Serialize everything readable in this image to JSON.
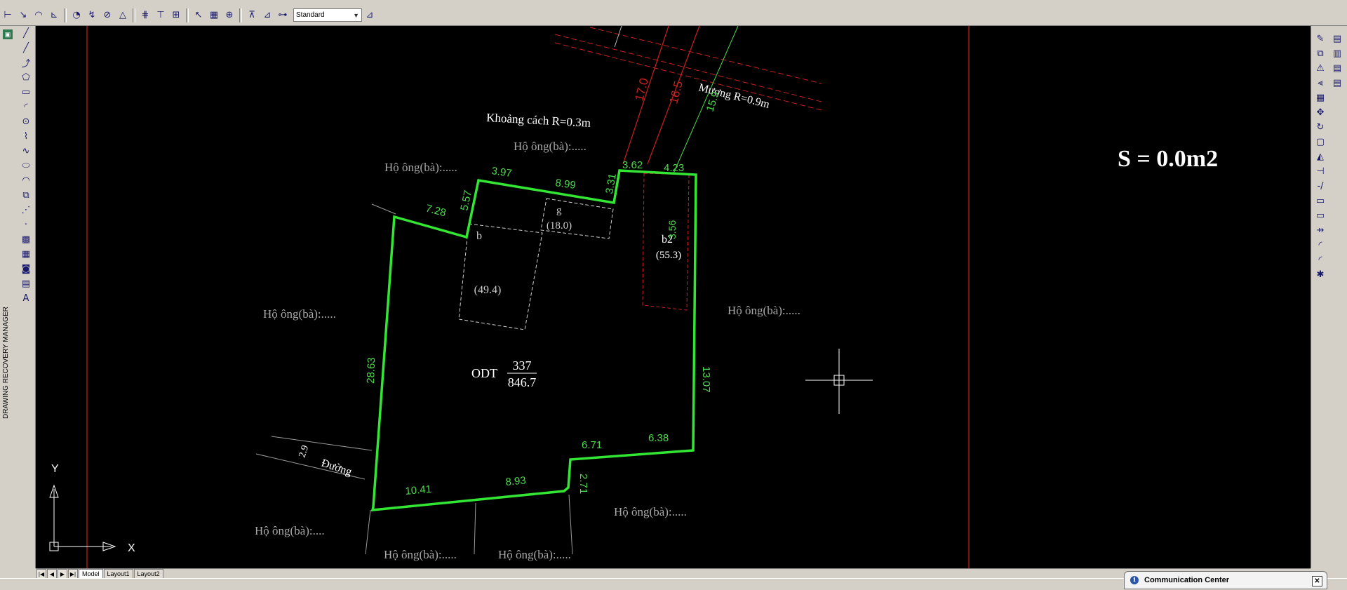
{
  "toolbar": {
    "dim_style_value": "Standard",
    "icons": [
      "dim-linear-icon",
      "dim-aligned-icon",
      "dim-arc-length-icon",
      "dim-ordinate-icon",
      "dim-radius-icon",
      "dim-jogged-icon",
      "dim-diameter-icon",
      "dim-angular-icon",
      "quick-dim-icon",
      "dim-baseline-icon",
      "dim-continue-icon",
      "quick-leader-icon",
      "tolerance-icon",
      "center-mark-icon",
      "dim-edit-icon",
      "dim-text-edit-icon",
      "dim-update-icon",
      "dim-style-icon"
    ]
  },
  "left_panel": {
    "label": "DRAWING RECOVERY MANAGER",
    "icon_glyph": "▣"
  },
  "draw_toolbar": {
    "glyphs": [
      "╱",
      "╱",
      "⤴",
      "⬠",
      "▭",
      "◜",
      "⊙",
      "⌇",
      "∿",
      "⬭",
      "◠",
      "⧉",
      "⋰",
      "·",
      "▩",
      "▦",
      "◙",
      "▤",
      "A"
    ]
  },
  "modify_toolbar": {
    "col1": [
      "✎",
      "⧉",
      "⚠",
      "⫷",
      "▦",
      "✥",
      "↻",
      "▢",
      "◭",
      "⊣",
      "-/",
      "▭",
      "▭",
      "⇸",
      "◜",
      "◜",
      "✱"
    ],
    "col2": [
      "▤",
      "▥",
      "▤",
      "▤"
    ]
  },
  "drawing": {
    "area_label": "S = 0.0m2",
    "parcel_prefix": "ODT",
    "parcel_number": "337",
    "parcel_area": "846.7",
    "building_b_label": "b",
    "building_b_area": "(49.4)",
    "building_g_label": "g",
    "building_g_area": "(18.0)",
    "building_b2_label": "b2",
    "building_b2_area": "(55.3)",
    "distance_label": "Khoảng cách R=0.3m",
    "canal_label": "Mương R=0.9m",
    "road_label": "Đường",
    "road_width": "2.9",
    "neighbor_label": "Hộ ông(bà):.....",
    "neighbor_label_short": "Hộ ông(bà):....",
    "edges": [
      "3.97",
      "8.99",
      "3.31",
      "3.62",
      "4.23",
      "5.57",
      "7.28",
      "28.63",
      "13.07",
      "6.38",
      "6.71",
      "2.71",
      "8.93",
      "10.41",
      "3.56"
    ],
    "red_dims": [
      "17.0",
      "16.5"
    ],
    "green_dim": "15.9",
    "ucs_x": "X",
    "ucs_y": "Y"
  },
  "colors": {
    "parcel": "#33e633",
    "neighbor_text": "#a8a8a8",
    "red_lines": "#cc1f1f",
    "canvas_bg": "#000000"
  },
  "tabs": {
    "items": [
      "Model",
      "Layout1",
      "Layout2"
    ]
  },
  "comm_center": {
    "title": "Communication Center"
  }
}
